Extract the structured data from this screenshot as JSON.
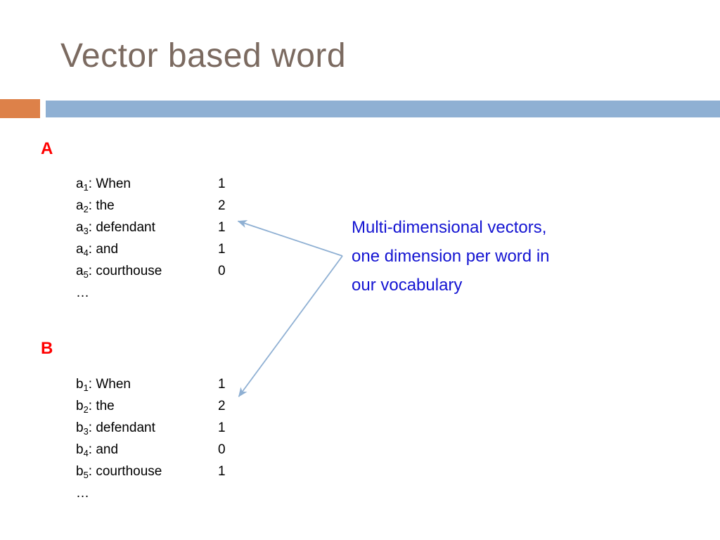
{
  "slide": {
    "title": "Vector based word",
    "theme": {
      "title_color": "#7b6a60",
      "accent_block_color": "#dd8149",
      "divider_bar_color": "#8fb0d3",
      "section_letter_color": "#ff0000",
      "annotation_color": "#1414d2",
      "arrow_color": "#8fb0d3",
      "background_color": "#ffffff"
    },
    "sections": [
      {
        "letter": "A",
        "ellipsis": "…",
        "rows": [
          {
            "prefix": "a",
            "index": "1",
            "separator": ":",
            "word": "When",
            "value": "1"
          },
          {
            "prefix": "a",
            "index": "2",
            "separator": ":",
            "word": "the",
            "value": "2"
          },
          {
            "prefix": "a",
            "index": "3",
            "separator": ":",
            "word": "defendant",
            "value": "1"
          },
          {
            "prefix": "a",
            "index": "4",
            "separator": ":",
            "word": "and",
            "value": "1"
          },
          {
            "prefix": "a",
            "index": "5",
            "separator": ":",
            "word": "courthouse",
            "value": "0"
          }
        ]
      },
      {
        "letter": "B",
        "ellipsis": "…",
        "rows": [
          {
            "prefix": "b",
            "index": "1",
            "separator": ":",
            "word": "When",
            "value": "1"
          },
          {
            "prefix": "b",
            "index": "2",
            "separator": ":",
            "word": "the",
            "value": "2"
          },
          {
            "prefix": "b",
            "index": "3",
            "separator": ":",
            "word": "defendant",
            "value": "1"
          },
          {
            "prefix": "b",
            "index": "4",
            "separator": ":",
            "word": "and",
            "value": "0"
          },
          {
            "prefix": "b",
            "index": "5",
            "separator": ":",
            "word": "courthouse",
            "value": "1"
          }
        ]
      }
    ],
    "annotation": {
      "line1": "Multi-dimensional vectors,",
      "line2": "one dimension per word in",
      "line3": "our vocabulary"
    }
  }
}
